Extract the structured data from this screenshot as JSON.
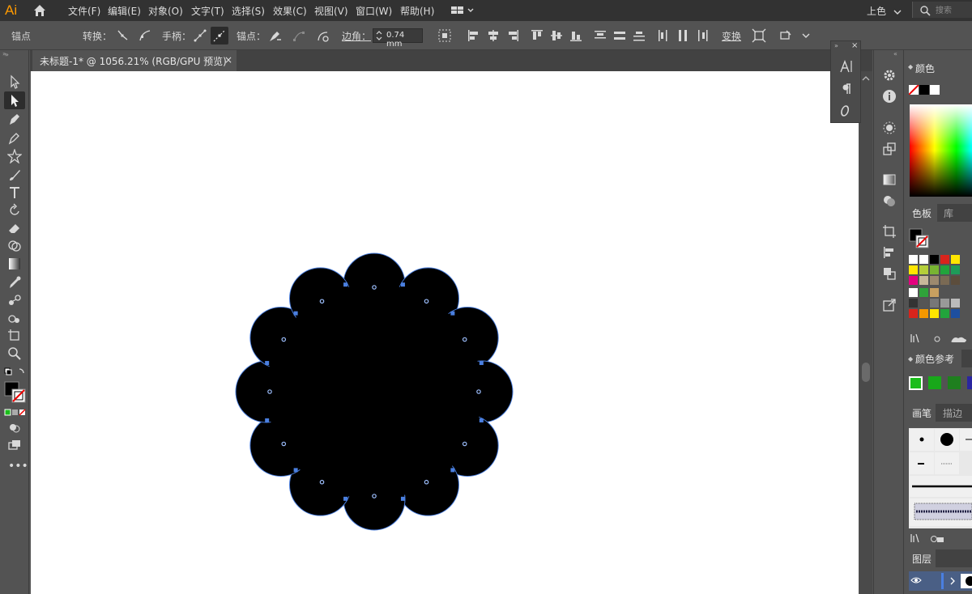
{
  "app": {
    "logo": "Ai",
    "menu": [
      "文件(F)",
      "编辑(E)",
      "对象(O)",
      "文字(T)",
      "选择(S)",
      "效果(C)",
      "视图(V)",
      "窗口(W)",
      "帮助(H)"
    ],
    "workspace": "上色",
    "search_placeholder": "搜索"
  },
  "control_bar": {
    "selection_label": "锚点",
    "convert_label": "转换：",
    "handles_label": "手柄：",
    "anchors_label": "锚点：",
    "corner_label": "边角：",
    "corner_value": "0.74 mm",
    "transform_label": "变换"
  },
  "document": {
    "tab_title": "未标题-1* @ 1056.21% (RGB/GPU 预览)",
    "close_glyph": "×"
  },
  "panels": {
    "color": {
      "title": "颜色"
    },
    "swatches": {
      "title": "色板",
      "library_tab": "库"
    },
    "color_guide": {
      "title": "颜色参考"
    },
    "brushes": {
      "title": "画笔",
      "stroke_tab": "描边"
    },
    "layers": {
      "title": "图层"
    }
  },
  "colors": {
    "swatch_rows": [
      [
        "#ffffff",
        "#ffffff",
        "#000000",
        "#d9241c",
        "#ffe600"
      ],
      [
        "#ffe600",
        "#b5cf3a",
        "#78b432",
        "#22a43c",
        "#1f9b58"
      ],
      [
        "#e3007f",
        "#c8b89a",
        "#9d8a6e",
        "#7a6a54",
        "#5c4d3c"
      ],
      [
        "#ffffff",
        "#2fa33a",
        "#c8a060",
        "#535353",
        "#535353"
      ],
      [
        "#333333",
        "#555555",
        "#777777",
        "#999999",
        "#bbbbbb"
      ],
      [
        "#d9241c",
        "#f39800",
        "#ffe600",
        "#22a43c",
        "#1d4fa0"
      ]
    ],
    "guide_swatches": [
      "#1bbd1b",
      "#18a81a",
      "#1f7f1f",
      "#2b26a0",
      "#c8187c"
    ],
    "accent": "#4a7fe0",
    "orange": "#ff9a00"
  },
  "shape": {
    "fill": "#000000",
    "outline": "#4a7fe0",
    "lobe_count": 12
  }
}
